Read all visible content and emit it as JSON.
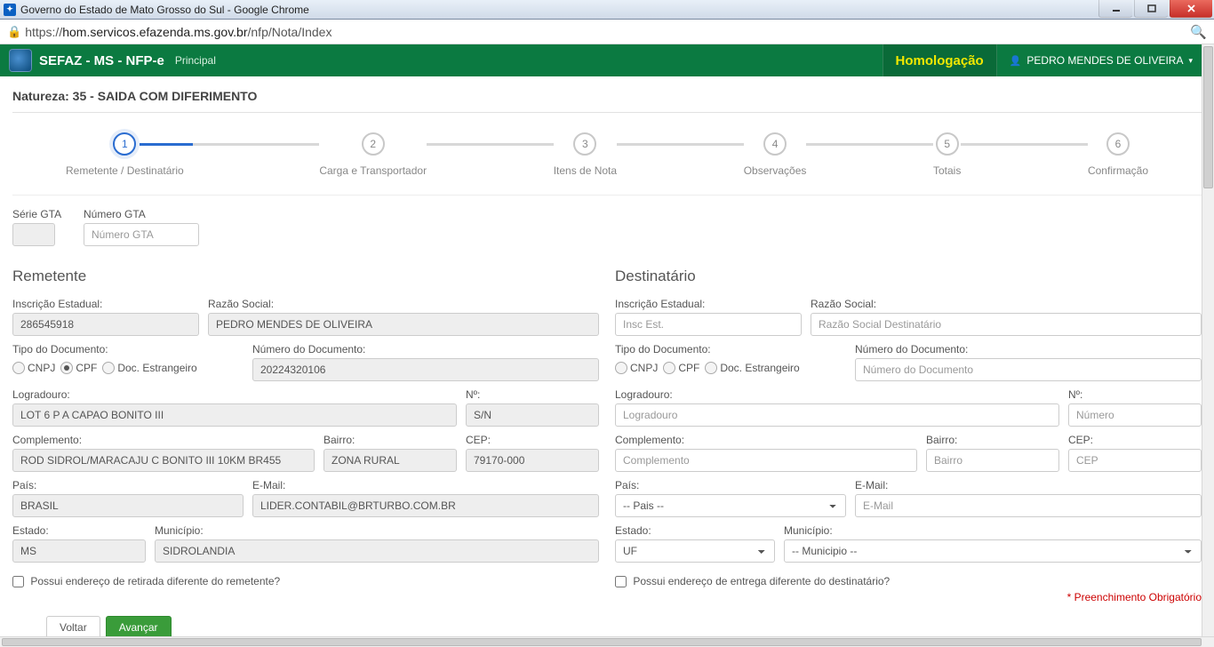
{
  "window": {
    "title": "Governo do Estado de Mato Grosso do Sul - Google Chrome",
    "url_prefix": "https://",
    "url_host": "hom.servicos.efazenda.ms.gov.br",
    "url_path": "/nfp/Nota/Index"
  },
  "header": {
    "brand": "SEFAZ - MS - NFP-e",
    "nav_principal": "Principal",
    "homolog": "Homologação",
    "user": "PEDRO MENDES DE OLIVEIRA"
  },
  "page": {
    "natureza_label": "Natureza: 35 - SAIDA COM DIFERIMENTO",
    "required_note": "* Preenchimento Obrigatório"
  },
  "steps": [
    {
      "num": "1",
      "label": "Remetente / Destinatário"
    },
    {
      "num": "2",
      "label": "Carga e Transportador"
    },
    {
      "num": "3",
      "label": "Itens de Nota"
    },
    {
      "num": "4",
      "label": "Observações"
    },
    {
      "num": "5",
      "label": "Totais"
    },
    {
      "num": "6",
      "label": "Confirmação"
    }
  ],
  "gta": {
    "serie_label": "Série GTA",
    "numero_label": "Número GTA",
    "numero_placeholder": "Número GTA"
  },
  "remetente": {
    "title": "Remetente",
    "ie_label": "Inscrição Estadual:",
    "ie_value": "286545918",
    "razao_label": "Razão Social:",
    "razao_value": "PEDRO MENDES DE OLIVEIRA",
    "tipodoc_label": "Tipo do Documento:",
    "opt_cnpj": "CNPJ",
    "opt_cpf": "CPF",
    "opt_estr": "Doc. Estrangeiro",
    "numdoc_label": "Número do Documento:",
    "numdoc_value": "20224320106",
    "logradouro_label": "Logradouro:",
    "logradouro_value": "LOT 6 P A CAPAO BONITO III",
    "numero_label": "Nº:",
    "numero_value": "S/N",
    "complemento_label": "Complemento:",
    "complemento_value": "ROD SIDROL/MARACAJU C BONITO III 10KM BR455",
    "bairro_label": "Bairro:",
    "bairro_value": "ZONA RURAL",
    "cep_label": "CEP:",
    "cep_value": "79170-000",
    "pais_label": "País:",
    "pais_value": "BRASIL",
    "email_label": "E-Mail:",
    "email_value": "LIDER.CONTABIL@BRTURBO.COM.BR",
    "estado_label": "Estado:",
    "estado_value": "MS",
    "municipio_label": "Município:",
    "municipio_value": "SIDROLANDIA",
    "checkbox_label": "Possui endereço de retirada diferente do remetente?"
  },
  "destinatario": {
    "title": "Destinatário",
    "ie_label": "Inscrição Estadual:",
    "ie_placeholder": "Insc Est.",
    "razao_label": "Razão Social:",
    "razao_placeholder": "Razão Social Destinatário",
    "tipodoc_label": "Tipo do Documento:",
    "opt_cnpj": "CNPJ",
    "opt_cpf": "CPF",
    "opt_estr": "Doc. Estrangeiro",
    "numdoc_label": "Número do Documento:",
    "numdoc_placeholder": "Número do Documento",
    "logradouro_label": "Logradouro:",
    "logradouro_placeholder": "Logradouro",
    "numero_label": "Nº:",
    "numero_placeholder": "Número",
    "complemento_label": "Complemento:",
    "complemento_placeholder": "Complemento",
    "bairro_label": "Bairro:",
    "bairro_placeholder": "Bairro",
    "cep_label": "CEP:",
    "cep_placeholder": "CEP",
    "pais_label": "País:",
    "pais_value": "-- Pais --",
    "email_label": "E-Mail:",
    "email_placeholder": "E-Mail",
    "estado_label": "Estado:",
    "estado_value": "UF",
    "municipio_label": "Município:",
    "municipio_value": "-- Municipio --",
    "checkbox_label": "Possui endereço de entrega diferente do destinatário?"
  },
  "buttons": {
    "voltar": "Voltar",
    "avancar": "Avançar"
  }
}
